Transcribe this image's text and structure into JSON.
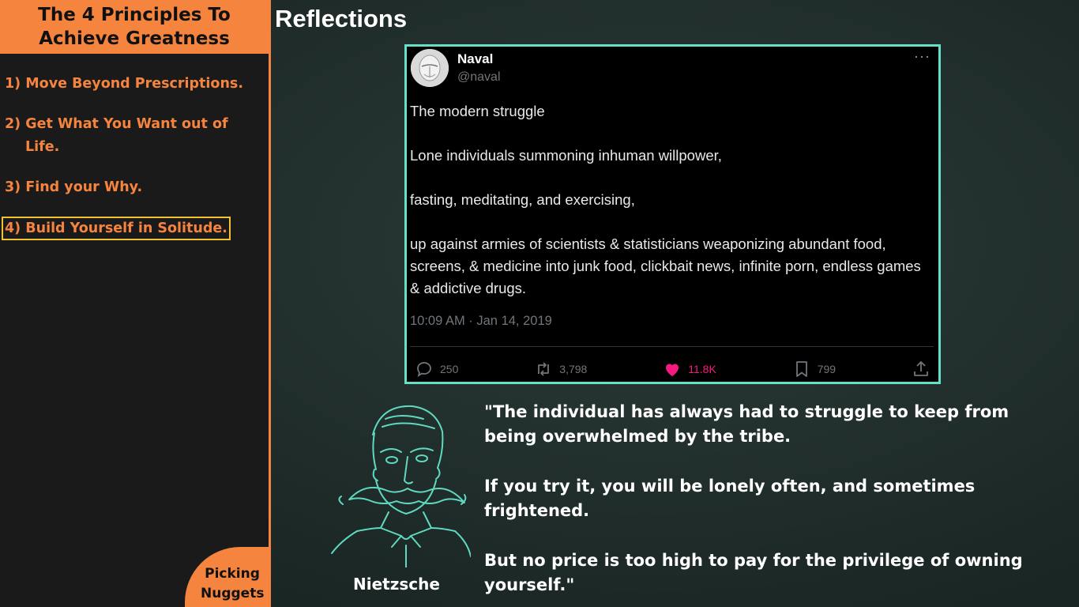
{
  "sidebar": {
    "title_line1": "The 4 Principles To",
    "title_line2": "Achieve Greatness",
    "items": [
      {
        "label": "1) Move Beyond Prescriptions."
      },
      {
        "label": "2) Get What You Want out of Life."
      },
      {
        "label": "3) Find your Why."
      },
      {
        "label": "4) Build Yourself in Solitude."
      }
    ],
    "active_index": 3,
    "brand_line1": "Picking",
    "brand_line2": "Nuggets"
  },
  "page": {
    "title": "Reflections"
  },
  "tweet": {
    "name": "Naval",
    "handle": "@naval",
    "more": "···",
    "paragraphs": [
      "The modern struggle",
      "Lone individuals summoning inhuman willpower,",
      "fasting, meditating, and exercising,",
      "up against armies of scientists & statisticians weaponizing abundant food, screens, & medicine into junk food, clickbait news, infinite porn, endless games & addictive drugs."
    ],
    "timestamp": "10:09 AM · Jan 14, 2019",
    "actions": {
      "replies": "250",
      "retweets": "3,798",
      "likes": "11.8K",
      "bookmarks": "799"
    },
    "colors": {
      "border": "#63e0c6",
      "like": "#f91880",
      "muted": "#71767b"
    }
  },
  "quote": {
    "paragraphs": [
      "\"The individual has always had to struggle to keep from being overwhelmed by the tribe.",
      "If you try it, you will be lonely often, and sometimes frightened.",
      "But no price is too high to pay for the privilege of owning yourself.\""
    ],
    "author": "Nietzsche"
  },
  "colors": {
    "accent": "#f4843e",
    "highlight": "#f2c230",
    "background": "#1f2e2c"
  }
}
